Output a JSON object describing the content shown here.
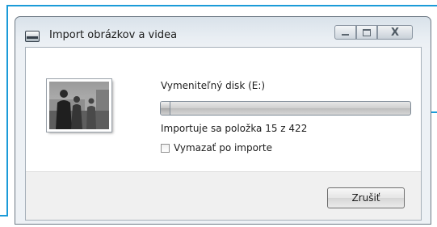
{
  "window": {
    "title": "Import obrázkov a videa",
    "controls": {
      "minimize_icon": "minimize-icon",
      "maximize_icon": "maximize-icon",
      "close_icon": "close-icon",
      "close_glyph": "X"
    }
  },
  "import": {
    "drive_label": "Vymeniteľný disk (E:)",
    "status_text": "Importuje sa položka 15 z 422",
    "current_item": 15,
    "total_items": 422,
    "progress_fraction": 0.035,
    "delete_after_import_label": "Vymazať po importe",
    "delete_after_import_checked": false,
    "thumbnail_icon": "photo-thumbnail"
  },
  "buttons": {
    "cancel_label": "Zrušiť"
  },
  "colors": {
    "callout": "#1b9bd8",
    "window_frame": "#6f7b86"
  }
}
